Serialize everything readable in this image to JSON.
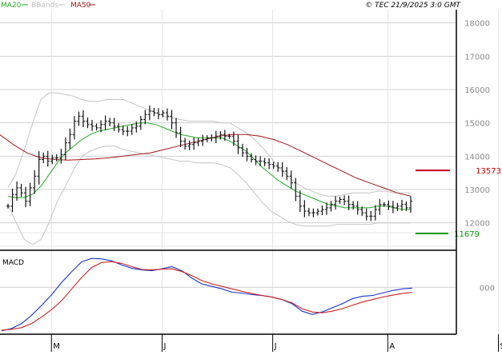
{
  "header": {
    "legend": [
      {
        "label": "MA20",
        "color": "#22aa22"
      },
      {
        "label": "BBands",
        "color": "#bdbdbd"
      },
      {
        "label": "MA50",
        "color": "#a11616"
      }
    ],
    "copyright": "© TEC 21/9/2025 3:0 GMT"
  },
  "chart_data": [
    {
      "type": "ohlc",
      "yticks": [
        "18000",
        "17000",
        "16000",
        "15000",
        "14000",
        "13000",
        "12000"
      ],
      "ytick_values": [
        18000,
        17000,
        16000,
        15000,
        14000,
        13000,
        12000
      ],
      "ylim": [
        11200,
        18400
      ],
      "xticks": [
        "M",
        "J",
        "J",
        "A",
        "S"
      ],
      "xtick_index": [
        10,
        35,
        60,
        86,
        111
      ],
      "grid": true,
      "levels": [
        {
          "name": "resistance",
          "value": 13573,
          "label": "13573",
          "color": "#cc0000"
        },
        {
          "name": "support",
          "value": 11679,
          "label": "11679",
          "color": "#009900"
        }
      ],
      "close": [
        12500,
        12850,
        13050,
        12900,
        12650,
        13050,
        13400,
        13900,
        14000,
        13850,
        13950,
        13950,
        14050,
        14400,
        14650,
        15050,
        15200,
        15050,
        14950,
        14900,
        14850,
        14950,
        15050,
        15000,
        14900,
        14800,
        14750,
        14750,
        14850,
        14900,
        15100,
        15250,
        15350,
        15300,
        15250,
        15300,
        15200,
        15000,
        14700,
        14450,
        14300,
        14350,
        14400,
        14450,
        14500,
        14550,
        14550,
        14600,
        14650,
        14600,
        14600,
        14450,
        14250,
        14100,
        14000,
        13900,
        13850,
        13850,
        13800,
        13750,
        13700,
        13650,
        13550,
        13400,
        13200,
        12800,
        12500,
        12350,
        12300,
        12300,
        12350,
        12400,
        12450,
        12550,
        12650,
        12700,
        12650,
        12550,
        12500,
        12400,
        12300,
        12200,
        12200,
        12400,
        12550,
        12550,
        12500,
        12450,
        12500,
        12550,
        12450,
        12650
      ],
      "ma20": [
        12800,
        12750,
        12760,
        12860,
        13100,
        13450,
        13800,
        14100,
        14300,
        14500,
        14650,
        14750,
        14800,
        14850,
        14900,
        14950,
        15000,
        15000,
        14950,
        14850,
        14750,
        14650,
        14600,
        14550,
        14550,
        14550,
        14550,
        14450,
        14300,
        14150,
        13900,
        13650,
        13450,
        13250,
        13100,
        12950,
        12850,
        12750,
        12650,
        12550,
        12500,
        12450,
        12450,
        12450,
        12450,
        12500,
        12500,
        12450,
        12400,
        12400
      ],
      "ma20_start": 0,
      "ma50": [
        14900,
        14650,
        14350,
        14100,
        13950,
        13900,
        13880,
        13900,
        13920,
        13950,
        14000,
        14050,
        14100,
        14200,
        14300,
        14400,
        14500,
        14600,
        14650,
        14650,
        14600,
        14500,
        14350,
        14150,
        13950,
        13750,
        13550,
        13350,
        13200,
        13050,
        12900,
        12800
      ],
      "bb_upper": [
        13050,
        13500,
        14200,
        15000,
        15700,
        15900,
        15900,
        15850,
        15800,
        15700,
        15650,
        15650,
        15700,
        15700,
        15700,
        15600,
        15500,
        15400,
        15300,
        15200,
        15150,
        15100,
        15050,
        15050,
        15050,
        15050,
        15000,
        15000,
        14850,
        14700,
        14500,
        14250,
        13950,
        13650,
        13400,
        13200,
        13050,
        12950,
        12850,
        12800,
        12800,
        12850,
        12900,
        12900,
        12900,
        12950,
        12950,
        12900,
        12900,
        12900
      ],
      "bb_lower": [
        12550,
        12000,
        11500,
        11350,
        11500,
        12000,
        12650,
        13100,
        13600,
        14000,
        14150,
        14250,
        14300,
        14300,
        14200,
        14150,
        14100,
        14050,
        14000,
        13950,
        13900,
        13850,
        13850,
        13800,
        13800,
        13800,
        13750,
        13650,
        13450,
        13200,
        12900,
        12600,
        12350,
        12200,
        12050,
        11950,
        11900,
        11900,
        11900,
        11900,
        11950,
        11950,
        11950,
        11950,
        11950,
        12000,
        12000,
        12000,
        12000,
        12000
      ]
    },
    {
      "type": "line",
      "title": "MACD",
      "yticks": [
        "000"
      ],
      "ytick_values": [
        0
      ],
      "ylim": [
        -2.8,
        2.05
      ],
      "series": [
        {
          "color": "#1a33cc",
          "values": [
            -2.65,
            -2.5,
            -2.2,
            -1.7,
            -1.1,
            -0.45,
            0.3,
            0.95,
            1.55,
            1.75,
            1.72,
            1.6,
            1.35,
            1.15,
            1.05,
            1.0,
            1.12,
            1.25,
            1.0,
            0.55,
            0.2,
            0.05,
            -0.1,
            -0.3,
            -0.35,
            -0.45,
            -0.5,
            -0.6,
            -0.75,
            -1.0,
            -1.45,
            -1.65,
            -1.5,
            -1.25,
            -1.0,
            -0.7,
            -0.55,
            -0.5,
            -0.35,
            -0.2,
            -0.1,
            -0.05
          ]
        },
        {
          "color": "#cc2222",
          "values": [
            -2.6,
            -2.55,
            -2.45,
            -2.2,
            -1.8,
            -1.35,
            -0.8,
            -0.1,
            0.6,
            1.2,
            1.5,
            1.55,
            1.45,
            1.25,
            1.08,
            1.05,
            1.1,
            1.12,
            0.95,
            0.7,
            0.4,
            0.2,
            0.05,
            -0.1,
            -0.25,
            -0.38,
            -0.5,
            -0.6,
            -0.75,
            -0.95,
            -1.3,
            -1.5,
            -1.55,
            -1.45,
            -1.3,
            -1.1,
            -0.9,
            -0.75,
            -0.6,
            -0.48,
            -0.38,
            -0.3
          ]
        }
      ]
    }
  ]
}
